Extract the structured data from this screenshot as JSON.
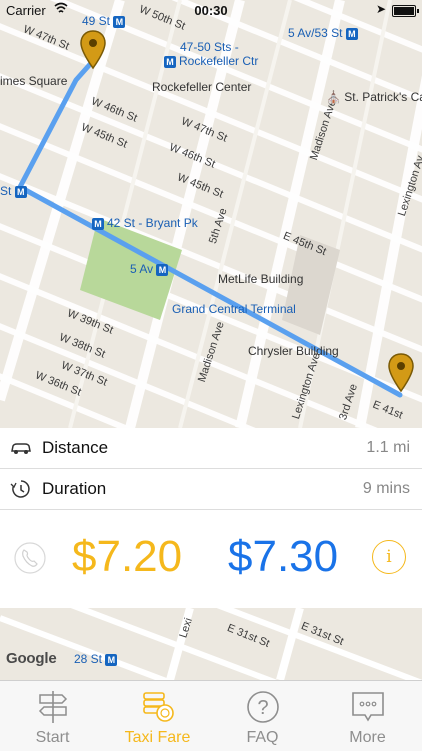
{
  "status_bar": {
    "carrier": "Carrier",
    "time": "00:30"
  },
  "map": {
    "street_labels": [
      "W 50th St",
      "W 47th St",
      "W 46th St",
      "W 45th St",
      "W 47th St",
      "W 46th St",
      "W 45th St",
      "W 39th St",
      "W 38th St",
      "W 37th St",
      "W 36th St",
      "Madison Ave",
      "5th Ave",
      "E 45th St",
      "Lexington Av",
      "Madison Ave",
      "Lexington Ave",
      "3rd Ave",
      "E 41st"
    ],
    "pois": {
      "station_49": "49 St",
      "station_5av53": "5 Av/53 St",
      "station_4750": "47-50 Sts -",
      "station_4750b": "Rockefeller Ctr",
      "rockefeller": "Rockefeller Center",
      "st_patricks": "St. Patrick's Cath",
      "times_square": "imes Square",
      "station_42": "42 St - Bryant Pk",
      "station_5av": "5 Av",
      "metlife": "MetLife Building",
      "grand_central": "Grand Central Terminal",
      "chrysler": "Chrysler Building",
      "station_st": "St",
      "station_28": "28 St"
    },
    "attribution": "Google",
    "lower_labels": [
      "E 31st St",
      "E 31st St",
      "Lexi"
    ]
  },
  "trip": {
    "distance_label": "Distance",
    "distance_value": "1.1 mi",
    "duration_label": "Duration",
    "duration_value": "9 mins"
  },
  "fares": {
    "fare_1": "$7.20",
    "fare_2": "$7.30",
    "fare_1_color": "#f5b81c",
    "fare_2_color": "#1a73e8"
  },
  "info_symbol": "i",
  "tabs": [
    {
      "label": "Start",
      "icon": "signpost-icon"
    },
    {
      "label": "Taxi Fare",
      "icon": "coins-icon",
      "active": true
    },
    {
      "label": "FAQ",
      "icon": "question-icon"
    },
    {
      "label": "More",
      "icon": "more-icon"
    }
  ]
}
